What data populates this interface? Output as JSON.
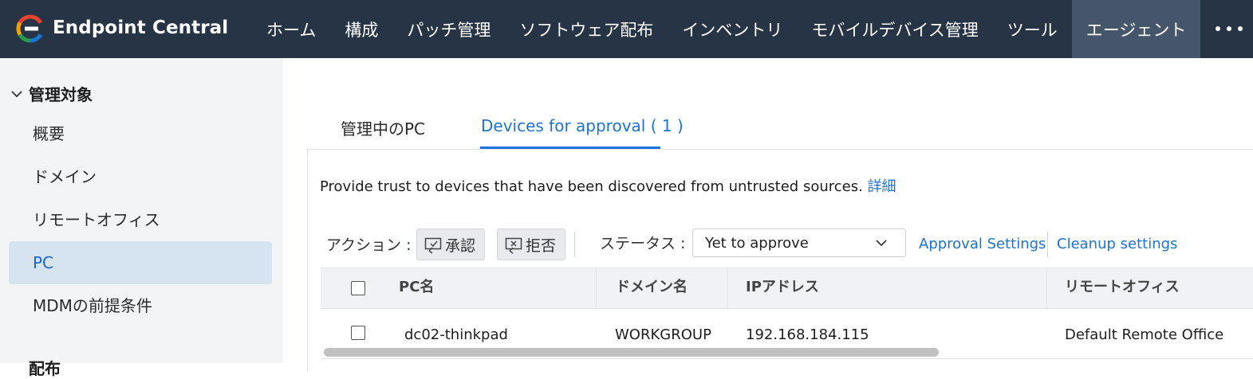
{
  "header": {
    "app_title": "Endpoint Central",
    "nav": [
      {
        "label": "ホーム"
      },
      {
        "label": "構成"
      },
      {
        "label": "パッチ管理"
      },
      {
        "label": "ソフトウェア配布"
      },
      {
        "label": "インベントリ"
      },
      {
        "label": "モバイルデバイス管理"
      },
      {
        "label": "ツール"
      },
      {
        "label": "エージェント",
        "active": true
      }
    ],
    "more_icon": "more-horizontal-icon"
  },
  "sidebar": {
    "section_title": "管理対象",
    "items": [
      {
        "label": "概要"
      },
      {
        "label": "ドメイン"
      },
      {
        "label": "リモートオフィス"
      },
      {
        "label": "PC",
        "active": true
      },
      {
        "label": "MDMの前提条件"
      }
    ],
    "next_section_partial": "配布"
  },
  "main": {
    "tabs": [
      {
        "label": "管理中のPC"
      },
      {
        "label": "Devices for approval ( 1 )",
        "active": true
      }
    ],
    "description": "Provide trust to devices that have been discovered from untrusted sources.",
    "description_link": "詳細",
    "actions_label": "アクション :",
    "approve_label": "承認",
    "reject_label": "拒否",
    "status_label": "ステータス :",
    "status_value": "Yet to approve",
    "approval_settings": "Approval Settings",
    "cleanup_settings": "Cleanup settings"
  },
  "table": {
    "columns": [
      "PC名",
      "ドメイン名",
      "IPアドレス",
      "リモートオフィス"
    ],
    "rows": [
      {
        "pc_name": "dc02-thinkpad",
        "domain": "WORKGROUP",
        "ip": "192.168.184.115",
        "remote_office": "Default Remote Office"
      }
    ]
  },
  "colors": {
    "topbar": "#263445",
    "nav_active": "#46566a",
    "accent": "#1a73d9",
    "sidebar_bg": "#f3f4f6",
    "sidebar_active": "#d6e3f1"
  }
}
